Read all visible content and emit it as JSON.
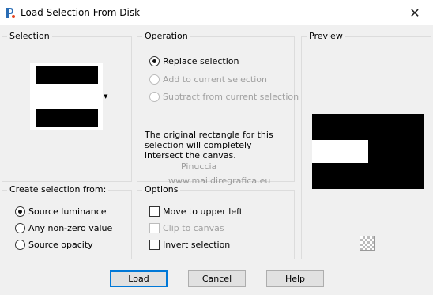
{
  "window": {
    "title": "Load Selection From Disk",
    "close_symbol": "✕",
    "icon": "paintshop-pro-icon"
  },
  "selection": {
    "label": "Selection"
  },
  "operation": {
    "label": "Operation",
    "options": [
      {
        "label": "Replace selection",
        "selected": true,
        "enabled": true
      },
      {
        "label": "Add to current selection",
        "selected": false,
        "enabled": false
      },
      {
        "label": "Subtract from current selection",
        "selected": false,
        "enabled": false
      }
    ],
    "info": "The original rectangle for this selection will completely intersect the canvas."
  },
  "preview": {
    "label": "Preview"
  },
  "create_from": {
    "label": "Create selection from:",
    "options": [
      {
        "label": "Source luminance",
        "selected": true
      },
      {
        "label": "Any non-zero value",
        "selected": false
      },
      {
        "label": "Source opacity",
        "selected": false
      }
    ]
  },
  "options": {
    "label": "Options",
    "items": [
      {
        "label": "Move to upper left",
        "checked": false,
        "enabled": true
      },
      {
        "label": "Clip to canvas",
        "checked": false,
        "enabled": false
      },
      {
        "label": "Invert selection",
        "checked": false,
        "enabled": true
      }
    ]
  },
  "watermark": {
    "line1": "Pinuccia",
    "line2": "www.maildiregrafica.eu"
  },
  "buttons": {
    "load": "Load",
    "cancel": "Cancel",
    "help": "Help"
  }
}
